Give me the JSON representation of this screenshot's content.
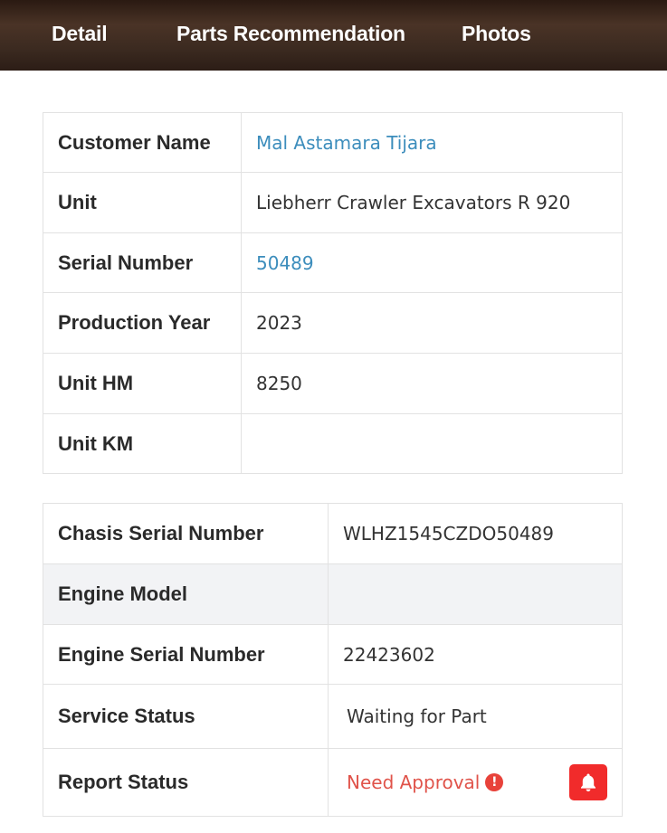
{
  "tabs": {
    "detail": "Detail",
    "parts": "Parts Recommendation",
    "photos": "Photos"
  },
  "unit_info": {
    "customer_name_label": "Customer Name",
    "customer_name": "Mal Astamara Tijara",
    "unit_label": "Unit",
    "unit": "Liebherr Crawler Excavators R 920",
    "serial_number_label": "Serial Number",
    "serial_number": "50489",
    "production_year_label": "Production Year",
    "production_year": "2023",
    "unit_hm_label": "Unit HM",
    "unit_hm": "8250",
    "unit_km_label": "Unit KM",
    "unit_km": ""
  },
  "engine_info": {
    "chasis_serial_label": "Chasis Serial Number",
    "chasis_serial": "WLHZ1545CZDO50489",
    "engine_model_label": "Engine Model",
    "engine_model": "",
    "engine_serial_label": "Engine Serial Number",
    "engine_serial": "22423602",
    "service_status_label": "Service Status",
    "service_status": "Waiting for Part",
    "report_status_label": "Report Status",
    "report_status": "Need Approval"
  },
  "icons": {
    "warning": "exclamation-circle-icon",
    "notify": "bell-icon"
  },
  "colors": {
    "link": "#3c8dbc",
    "alert": "#e0534a",
    "bell_button": "#f12b2b",
    "header_bg": "#3b2a20"
  }
}
